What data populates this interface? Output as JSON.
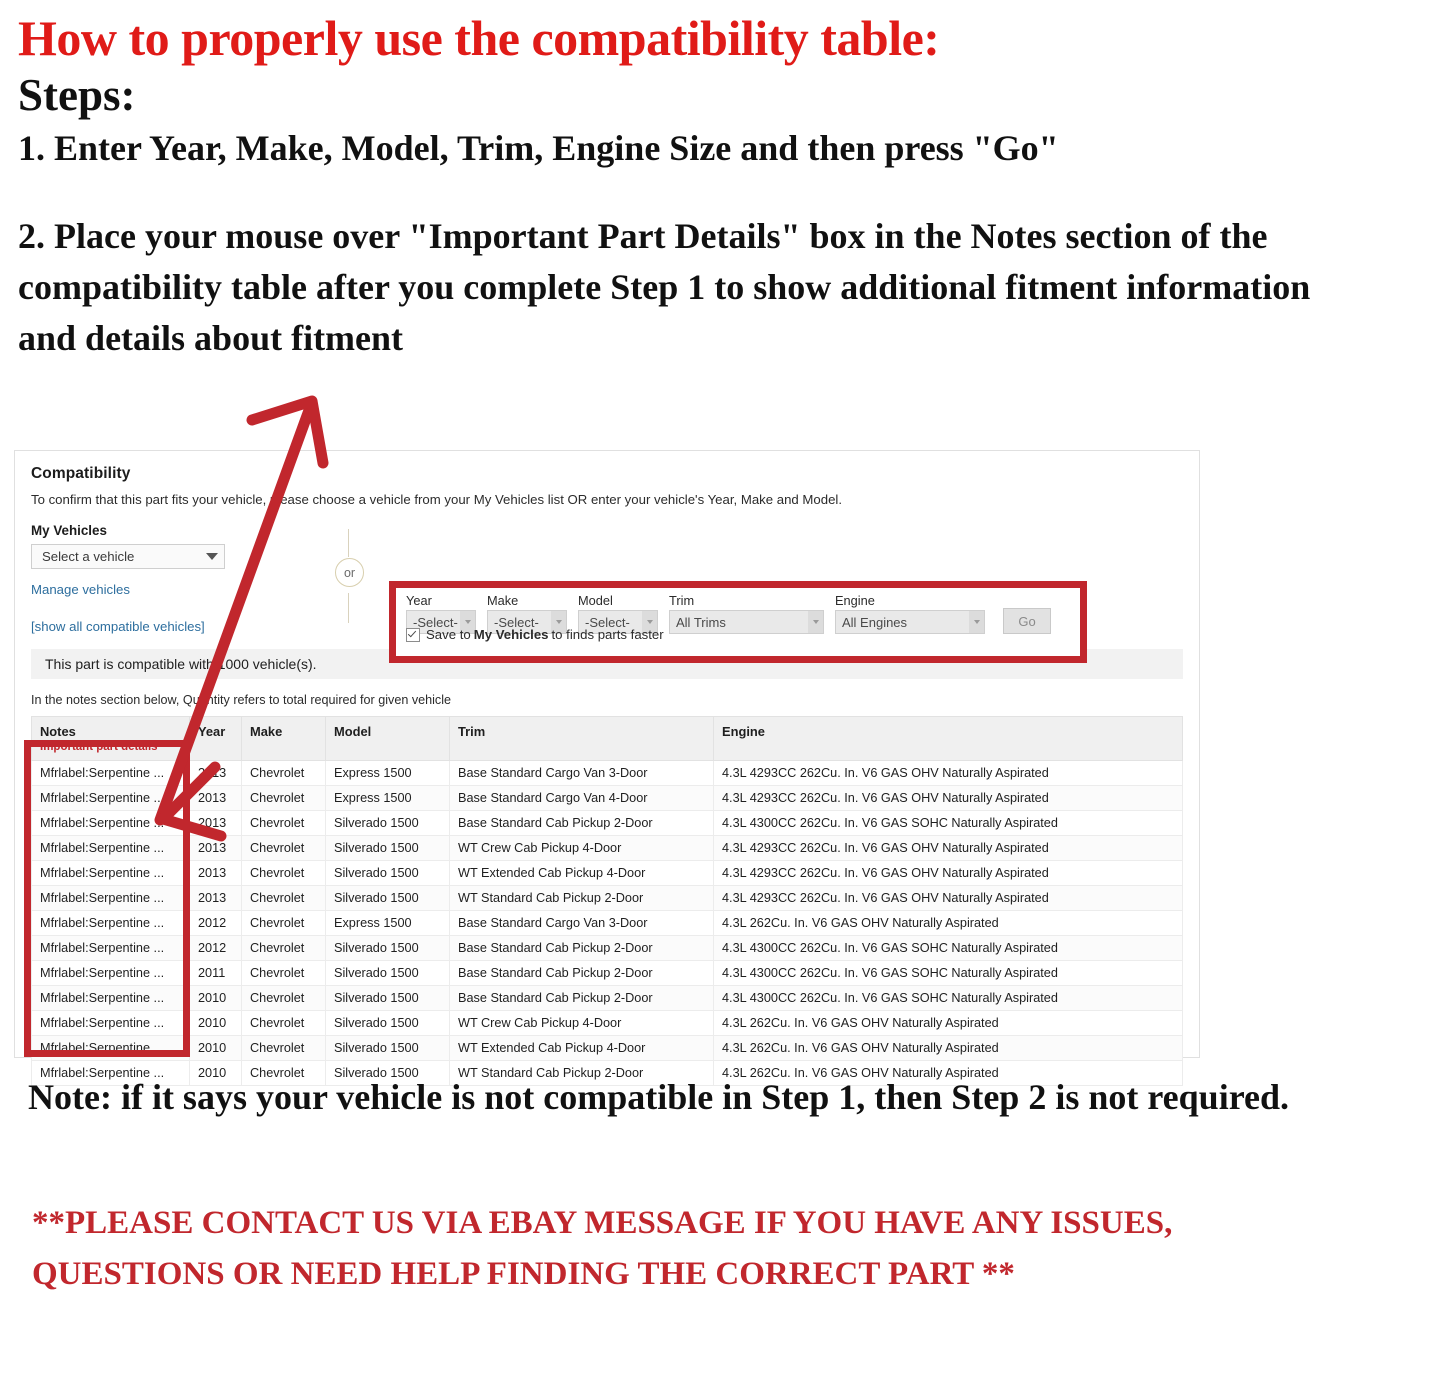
{
  "headline": {
    "title": "How to properly use the compatibility table:",
    "steps_label": "Steps:",
    "step1": "1. Enter Year, Make, Model, Trim, Engine Size and then press \"Go\"",
    "step2": "2. Place your mouse over \"Important Part Details\" box in the Notes section of the compatibility table after you complete Step 1 to show additional fitment information and details about fitment"
  },
  "compatibility": {
    "title": "Compatibility",
    "subtitle": "To confirm that this part fits your vehicle, please choose a vehicle from your My Vehicles list OR enter your vehicle's Year, Make and Model.",
    "my_vehicles_label": "My Vehicles",
    "my_vehicles_value": "Select a vehicle",
    "manage_vehicles_link": "Manage vehicles",
    "show_all_link": "[show all compatible vehicles]",
    "or_label": "or",
    "fields": {
      "year_label": "Year",
      "year_value": "-Select-",
      "make_label": "Make",
      "make_value": "-Select-",
      "model_label": "Model",
      "model_value": "-Select-",
      "trim_label": "Trim",
      "trim_value": "All Trims",
      "engine_label": "Engine",
      "engine_value": "All Engines",
      "go_label": "Go"
    },
    "save_checkbox": {
      "prefix": "Save to",
      "bold": "My Vehicles",
      "suffix": "to finds parts faster"
    },
    "banner": "This part is compatible with 1000 vehicle(s).",
    "qty_note": "In the notes section below, Quantity refers to total required for given vehicle",
    "table": {
      "headers": {
        "notes": "Notes",
        "notes_sub": "Important part details",
        "year": "Year",
        "make": "Make",
        "model": "Model",
        "trim": "Trim",
        "engine": "Engine"
      },
      "rows": [
        {
          "notes": "Mfrlabel:Serpentine ...",
          "year": "2013",
          "make": "Chevrolet",
          "model": "Express 1500",
          "trim": "Base Standard Cargo Van 3-Door",
          "engine": "4.3L 4293CC 262Cu. In. V6 GAS OHV Naturally Aspirated"
        },
        {
          "notes": "Mfrlabel:Serpentine ...",
          "year": "2013",
          "make": "Chevrolet",
          "model": "Express 1500",
          "trim": "Base Standard Cargo Van 4-Door",
          "engine": "4.3L 4293CC 262Cu. In. V6 GAS OHV Naturally Aspirated"
        },
        {
          "notes": "Mfrlabel:Serpentine ...",
          "year": "2013",
          "make": "Chevrolet",
          "model": "Silverado 1500",
          "trim": "Base Standard Cab Pickup 2-Door",
          "engine": "4.3L 4300CC 262Cu. In. V6 GAS SOHC Naturally Aspirated"
        },
        {
          "notes": "Mfrlabel:Serpentine ...",
          "year": "2013",
          "make": "Chevrolet",
          "model": "Silverado 1500",
          "trim": "WT Crew Cab Pickup 4-Door",
          "engine": "4.3L 4293CC 262Cu. In. V6 GAS OHV Naturally Aspirated"
        },
        {
          "notes": "Mfrlabel:Serpentine ...",
          "year": "2013",
          "make": "Chevrolet",
          "model": "Silverado 1500",
          "trim": "WT Extended Cab Pickup 4-Door",
          "engine": "4.3L 4293CC 262Cu. In. V6 GAS OHV Naturally Aspirated"
        },
        {
          "notes": "Mfrlabel:Serpentine ...",
          "year": "2013",
          "make": "Chevrolet",
          "model": "Silverado 1500",
          "trim": "WT Standard Cab Pickup 2-Door",
          "engine": "4.3L 4293CC 262Cu. In. V6 GAS OHV Naturally Aspirated"
        },
        {
          "notes": "Mfrlabel:Serpentine ...",
          "year": "2012",
          "make": "Chevrolet",
          "model": "Express 1500",
          "trim": "Base Standard Cargo Van 3-Door",
          "engine": "4.3L 262Cu. In. V6 GAS OHV Naturally Aspirated"
        },
        {
          "notes": "Mfrlabel:Serpentine ...",
          "year": "2012",
          "make": "Chevrolet",
          "model": "Silverado 1500",
          "trim": "Base Standard Cab Pickup 2-Door",
          "engine": "4.3L 4300CC 262Cu. In. V6 GAS SOHC Naturally Aspirated"
        },
        {
          "notes": "Mfrlabel:Serpentine ...",
          "year": "2011",
          "make": "Chevrolet",
          "model": "Silverado 1500",
          "trim": "Base Standard Cab Pickup 2-Door",
          "engine": "4.3L 4300CC 262Cu. In. V6 GAS SOHC Naturally Aspirated"
        },
        {
          "notes": "Mfrlabel:Serpentine ...",
          "year": "2010",
          "make": "Chevrolet",
          "model": "Silverado 1500",
          "trim": "Base Standard Cab Pickup 2-Door",
          "engine": "4.3L 4300CC 262Cu. In. V6 GAS SOHC Naturally Aspirated"
        },
        {
          "notes": "Mfrlabel:Serpentine ...",
          "year": "2010",
          "make": "Chevrolet",
          "model": "Silverado 1500",
          "trim": "WT Crew Cab Pickup 4-Door",
          "engine": "4.3L 262Cu. In. V6 GAS OHV Naturally Aspirated"
        },
        {
          "notes": "Mfrlabel:Serpentine ...",
          "year": "2010",
          "make": "Chevrolet",
          "model": "Silverado 1500",
          "trim": "WT Extended Cab Pickup 4-Door",
          "engine": "4.3L 262Cu. In. V6 GAS OHV Naturally Aspirated"
        },
        {
          "notes": "Mfrlabel:Serpentine ...",
          "year": "2010",
          "make": "Chevrolet",
          "model": "Silverado 1500",
          "trim": "WT Standard Cab Pickup 2-Door",
          "engine": "4.3L 262Cu. In. V6 GAS OHV Naturally Aspirated"
        }
      ]
    }
  },
  "footer": {
    "note": "Note: if it says your vehicle is not compatible in Step 1, then Step 2 is not required.",
    "contact": "**PLEASE CONTACT US VIA EBAY MESSAGE IF YOU HAVE ANY ISSUES, QUESTIONS OR NEED HELP FINDING THE CORRECT PART **"
  },
  "colors": {
    "red_accent": "#c1272d",
    "headline_red": "#e01b18",
    "link_blue": "#2d6e9e"
  }
}
